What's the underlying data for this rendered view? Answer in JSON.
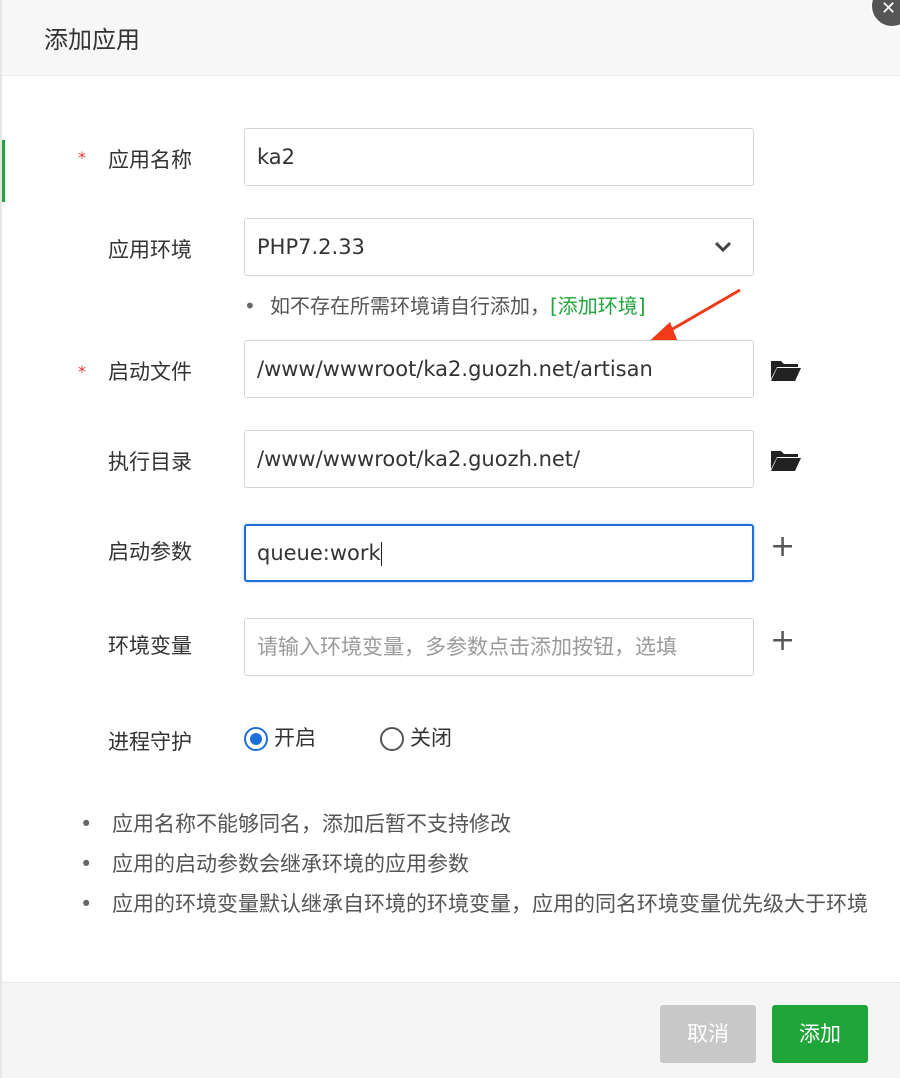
{
  "dialog": {
    "title": "添加应用",
    "close_icon": "close-icon"
  },
  "form": {
    "app_name": {
      "label": "应用名称",
      "required": "*",
      "value": "ka2"
    },
    "app_env": {
      "label": "应用环境",
      "value": "PHP7.2.33",
      "icon": "chevron-down-icon"
    },
    "env_hint": {
      "bullet": "•",
      "text": "如不存在所需环境请自行添加，",
      "link": "[添加环境]"
    },
    "start_file": {
      "label": "启动文件",
      "required": "*",
      "value": "/www/wwwroot/ka2.guozh.net/artisan",
      "icon": "folder-open-icon"
    },
    "exec_dir": {
      "label": "执行目录",
      "value": "/www/wwwroot/ka2.guozh.net/",
      "icon": "folder-open-icon"
    },
    "start_args": {
      "label": "启动参数",
      "value": "queue:work",
      "icon": "plus-icon",
      "add_symbol": "+"
    },
    "env_vars": {
      "label": "环境变量",
      "placeholder": "请输入环境变量，多参数点击添加按钮，选填",
      "icon": "plus-icon",
      "add_symbol": "+"
    },
    "daemon": {
      "label": "进程守护",
      "options": [
        {
          "label": "开启",
          "checked": true
        },
        {
          "label": "关闭",
          "checked": false
        }
      ]
    }
  },
  "notes": [
    {
      "bullet": "•",
      "text": "应用名称不能够同名，添加后暂不支持修改"
    },
    {
      "bullet": "•",
      "text": "应用的启动参数会继承环境的应用参数"
    },
    {
      "bullet": "•",
      "text": "应用的环境变量默认继承自环境的环境变量，应用的同名环境变量优先级大于环境"
    }
  ],
  "footer": {
    "cancel_label": "取消",
    "confirm_label": "添加"
  },
  "colors": {
    "accent_green": "#20a53a",
    "focus_blue": "#1e6fd9",
    "required_red": "#e53935",
    "annotation_arrow": "#f03a17"
  }
}
